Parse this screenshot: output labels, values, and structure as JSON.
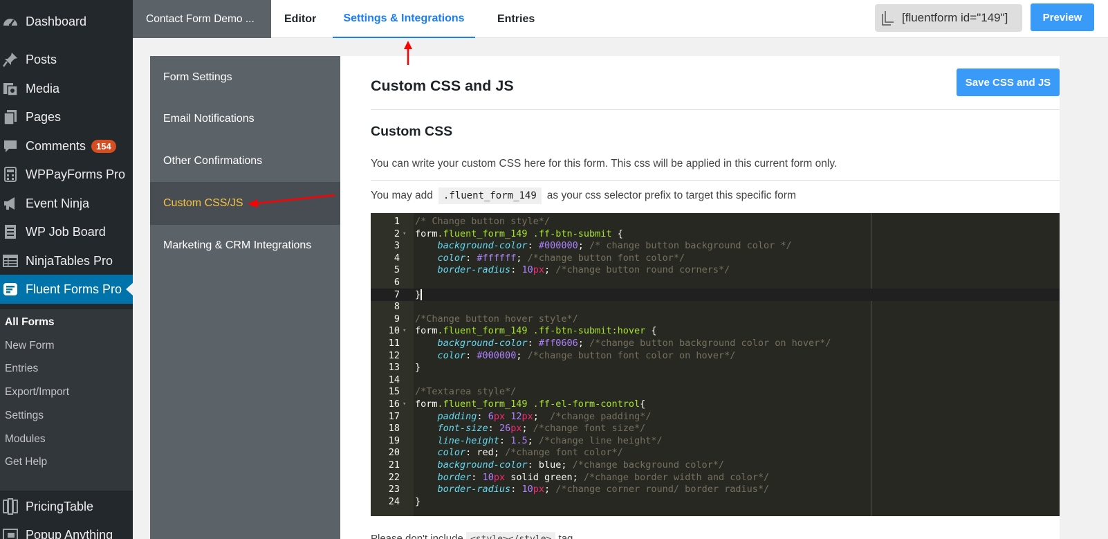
{
  "wp_sidebar": {
    "items": [
      {
        "label": "Dashboard",
        "icon": "dashboard-icon"
      },
      {
        "label": "Posts",
        "icon": "pin-icon"
      },
      {
        "label": "Media",
        "icon": "media-icon"
      },
      {
        "label": "Pages",
        "icon": "pages-icon"
      },
      {
        "label": "Comments",
        "icon": "comment-icon",
        "badge": "154"
      },
      {
        "label": "WPPayForms Pro",
        "icon": "calculator-icon"
      },
      {
        "label": "Event Ninja",
        "icon": "megaphone-icon"
      },
      {
        "label": "WP Job Board",
        "icon": "list-icon"
      },
      {
        "label": "NinjaTables Pro",
        "icon": "table-icon"
      },
      {
        "label": "Fluent Forms Pro",
        "icon": "fluent-forms-icon",
        "active": true
      },
      {
        "label": "PricingTable",
        "icon": "pricing-icon"
      },
      {
        "label": "Popup Anything",
        "icon": "popup-icon"
      }
    ],
    "submenu": [
      "All Forms",
      "New Form",
      "Entries",
      "Export/Import",
      "Settings",
      "Modules",
      "Get Help"
    ]
  },
  "topbar": {
    "form_title": "Contact Form Demo ...",
    "tabs": [
      "Editor",
      "Settings & Integrations",
      "Entries"
    ],
    "active_tab": "Settings & Integrations",
    "shortcode": "[fluentform id=\"149\"]",
    "preview_label": "Preview"
  },
  "settings_nav": {
    "items": [
      "Form Settings",
      "Email Notifications",
      "Other Confirmations",
      "Custom CSS/JS",
      "Marketing & CRM Integrations"
    ],
    "active": "Custom CSS/JS"
  },
  "content": {
    "title": "Custom CSS and JS",
    "save_label": "Save CSS and JS",
    "section_title": "Custom CSS",
    "description": "You can write your custom CSS here for this form. This css will be applied in this current form only.",
    "prefix_before": "You may add",
    "prefix_code": ".fluent_form_149",
    "prefix_after": "as your css selector prefix to target this specific form",
    "bottom_before": "Please don't include",
    "bottom_code": "<style></style>",
    "bottom_after": "tag"
  },
  "colors": {
    "wp_sidebar_bg": "#23282d",
    "wp_active": "#0073aa",
    "accent_blue": "#1a7efb",
    "button_blue": "#3a9af7",
    "nav_bg": "#5b6268",
    "nav_active_text": "#f6c343",
    "annotation_red": "#ff0000",
    "editor_bg": "#272822"
  },
  "editor": {
    "active_line": 7,
    "lines": [
      [
        [
          "/* Change button style*/",
          "cm"
        ]
      ],
      [
        [
          "form",
          "pl"
        ],
        [
          ".fluent_form_149 .ff-btn-submit",
          "gr"
        ],
        [
          " {",
          "pl"
        ]
      ],
      [
        [
          "    ",
          "pl"
        ],
        [
          "background-color",
          "pr"
        ],
        [
          ": ",
          "pl"
        ],
        [
          "#000000",
          "nm"
        ],
        [
          "; ",
          "pl"
        ],
        [
          "/* change button background color */",
          "cm"
        ]
      ],
      [
        [
          "    ",
          "pl"
        ],
        [
          "color",
          "pr"
        ],
        [
          ": ",
          "pl"
        ],
        [
          "#ffffff",
          "nm"
        ],
        [
          "; ",
          "pl"
        ],
        [
          "/*change button font color*/",
          "cm"
        ]
      ],
      [
        [
          "    ",
          "pl"
        ],
        [
          "border-radius",
          "pr"
        ],
        [
          ": ",
          "pl"
        ],
        [
          "10",
          "nm"
        ],
        [
          "px",
          "kw"
        ],
        [
          "; ",
          "pl"
        ],
        [
          "/*change button round corners*/",
          "cm"
        ]
      ],
      [],
      [
        [
          "}",
          "pl"
        ]
      ],
      [],
      [
        [
          "/*Change button hover style*/",
          "cm"
        ]
      ],
      [
        [
          "form",
          "pl"
        ],
        [
          ".fluent_form_149 .ff-btn-submit:hover",
          "gr"
        ],
        [
          " {",
          "pl"
        ]
      ],
      [
        [
          "    ",
          "pl"
        ],
        [
          "background-color",
          "pr"
        ],
        [
          ": ",
          "pl"
        ],
        [
          "#ff0606",
          "nm"
        ],
        [
          "; ",
          "pl"
        ],
        [
          "/*change button background color on hover*/",
          "cm"
        ]
      ],
      [
        [
          "    ",
          "pl"
        ],
        [
          "color",
          "pr"
        ],
        [
          ": ",
          "pl"
        ],
        [
          "#000000",
          "nm"
        ],
        [
          "; ",
          "pl"
        ],
        [
          "/*change button font color on hover*/",
          "cm"
        ]
      ],
      [
        [
          "}",
          "pl"
        ]
      ],
      [],
      [
        [
          "/*Textarea style*/",
          "cm"
        ]
      ],
      [
        [
          "form",
          "pl"
        ],
        [
          ".fluent_form_149 .ff-el-form-control",
          "gr"
        ],
        [
          "{",
          "pl"
        ]
      ],
      [
        [
          "    ",
          "pl"
        ],
        [
          "padding",
          "pr"
        ],
        [
          ": ",
          "pl"
        ],
        [
          "6",
          "nm"
        ],
        [
          "px",
          "kw"
        ],
        [
          " ",
          "pl"
        ],
        [
          "12",
          "nm"
        ],
        [
          "px",
          "kw"
        ],
        [
          ";  ",
          "pl"
        ],
        [
          "/*change padding*/",
          "cm"
        ]
      ],
      [
        [
          "    ",
          "pl"
        ],
        [
          "font-size",
          "pr"
        ],
        [
          ": ",
          "pl"
        ],
        [
          "26",
          "nm"
        ],
        [
          "px",
          "kw"
        ],
        [
          "; ",
          "pl"
        ],
        [
          "/*change font size*/",
          "cm"
        ]
      ],
      [
        [
          "    ",
          "pl"
        ],
        [
          "line-height",
          "pr"
        ],
        [
          ": ",
          "pl"
        ],
        [
          "1.5",
          "nm"
        ],
        [
          "; ",
          "pl"
        ],
        [
          "/*change line height*/",
          "cm"
        ]
      ],
      [
        [
          "    ",
          "pl"
        ],
        [
          "color",
          "pr"
        ],
        [
          ": ",
          "pl"
        ],
        [
          "red",
          "pl"
        ],
        [
          "; ",
          "pl"
        ],
        [
          "/*change font color*/",
          "cm"
        ]
      ],
      [
        [
          "    ",
          "pl"
        ],
        [
          "background-color",
          "pr"
        ],
        [
          ": ",
          "pl"
        ],
        [
          "blue",
          "pl"
        ],
        [
          "; ",
          "pl"
        ],
        [
          "/*change background color*/",
          "cm"
        ]
      ],
      [
        [
          "    ",
          "pl"
        ],
        [
          "border",
          "pr"
        ],
        [
          ": ",
          "pl"
        ],
        [
          "10",
          "nm"
        ],
        [
          "px",
          "kw"
        ],
        [
          " solid green; ",
          "pl"
        ],
        [
          "/*change border width and color*/",
          "cm"
        ]
      ],
      [
        [
          "    ",
          "pl"
        ],
        [
          "border-radius",
          "pr"
        ],
        [
          ": ",
          "pl"
        ],
        [
          "10",
          "nm"
        ],
        [
          "px",
          "kw"
        ],
        [
          "; ",
          "pl"
        ],
        [
          "/*change corner round/ border radius*/",
          "cm"
        ]
      ],
      [
        [
          "}",
          "pl"
        ]
      ]
    ],
    "fold_lines": [
      2,
      10,
      16
    ],
    "token_colors": {
      "cm": "#75715e",
      "pl": "#f8f8f2",
      "gr": "#a6e22e",
      "pr": "#66d9ef",
      "nm": "#ae81ff",
      "kw": "#f92672"
    }
  }
}
